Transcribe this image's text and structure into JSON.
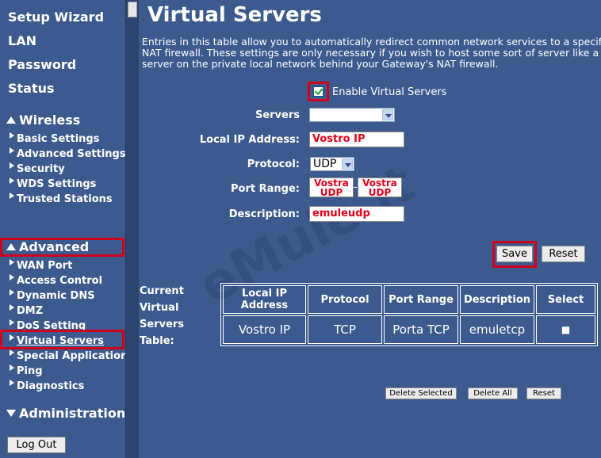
{
  "sidebar": {
    "top_links": [
      "Setup Wizard",
      "LAN",
      "Password",
      "Status"
    ],
    "wireless": {
      "title": "Wireless",
      "items": [
        "Basic Settings",
        "Advanced Settings",
        "Security",
        "WDS Settings",
        "Trusted Stations"
      ]
    },
    "advanced": {
      "title": "Advanced",
      "items": [
        "WAN Port",
        "Access Control",
        "Dynamic DNS",
        "DMZ",
        "DoS Setting",
        "Virtual Servers",
        "Special Applications",
        "Ping",
        "Diagnostics"
      ]
    },
    "administration": {
      "title": "Administration"
    },
    "logout_label": "Log Out"
  },
  "main": {
    "title": "Virtual Servers",
    "intro": "Entries in this table allow you to automatically redirect common network services to a specific NAT firewall. These settings are only necessary if you wish to host some sort of server like a server on the private local network behind your Gateway's NAT firewall.",
    "enable_label": "Enable Virtual Servers",
    "enable_checked": true,
    "form": {
      "servers_label": "Servers",
      "servers_value": "",
      "local_ip_label": "Local IP Address:",
      "local_ip_value": "Vostro IP",
      "protocol_label": "Protocol:",
      "protocol_value": "UDP",
      "port_range_label": "Port Range:",
      "port_from": "Vostra UDP",
      "port_to": "Vostra UDP",
      "port_sep": "-",
      "description_label": "Description:",
      "description_value": "emuleudp"
    },
    "save_label": "Save",
    "reset_label": "Reset",
    "table": {
      "caption": "Current Virtual Servers Table:",
      "headers": [
        "Local IP Address",
        "Protocol",
        "Port Range",
        "Description",
        "Select"
      ],
      "rows": [
        {
          "local_ip": "Vostro IP",
          "protocol": "TCP",
          "port_range": "Porta TCP",
          "description": "emuletcp",
          "select": "■"
        }
      ]
    },
    "delete_selected_label": "Delete Selected",
    "delete_all_label": "Delete All",
    "table_reset_label": "Reset",
    "watermark": "eMule.it"
  },
  "colors": {
    "background": "#3d5a8f",
    "highlight": "#d0021b",
    "field_text": "#e2001a"
  }
}
